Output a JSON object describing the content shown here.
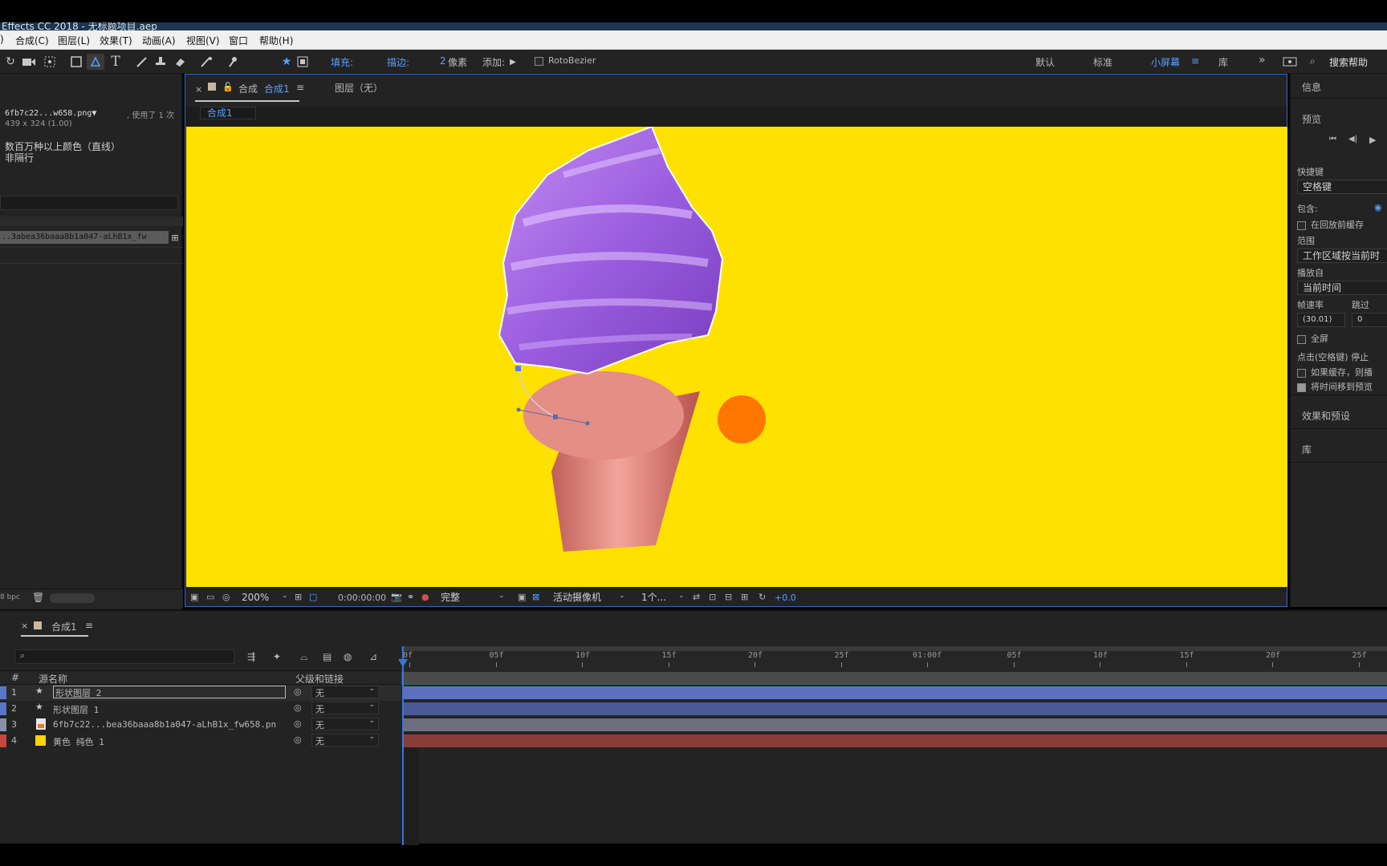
{
  "title_bar": {
    "text": "Effects CC 2018 - 无标题项目.aep"
  },
  "menu": [
    "合成(C)",
    "图层(L)",
    "效果(T)",
    "动画(A)",
    "视图(V)",
    "窗口",
    "帮助(H)"
  ],
  "toolbar": {
    "fill_label": "填充:",
    "stroke_label": "描边:",
    "stroke_width": "2",
    "stroke_unit": "像素",
    "add_label": "添加:",
    "rotobezier_label": "RotoBezier",
    "workspaces": [
      "默认",
      "标准",
      "小屏幕",
      "库"
    ],
    "active_workspace": "小屏幕",
    "search_help": "搜索帮助",
    "accent_color": "#2d8ceb"
  },
  "project": {
    "filename": "6fb7c22...w658.png▼",
    "used": ", 使用了 1 次",
    "dimensions": "439 x 324 (1.00)",
    "color_info": "数百万种以上颜色（直线）",
    "interlace": "非隔行",
    "selected_item": "..3abea36baaa8b1a047-aLhB1x_fw",
    "bpc": "8 bpc"
  },
  "comp_viewer": {
    "tab_label": "合成",
    "tab_name": "合成1",
    "layer_tab": "图层（无）",
    "breadcrumb": "合成1",
    "background_color": "#ffe100",
    "footer": {
      "zoom": "200%",
      "timecode": "0:00:00:00",
      "resolution": "完整",
      "camera": "活动摄像机",
      "views": "1个...",
      "exposure": "+0.0"
    }
  },
  "right_panel": {
    "info": "信息",
    "preview": "预览",
    "shortcut_label": "快捷键",
    "shortcut_value": "空格键",
    "include_label": "包含:",
    "cache_before_play": "在回放前缓存",
    "range_label": "范围",
    "range_value": "工作区域按当前时",
    "play_from_label": "播放自",
    "play_from_value": "当前时间",
    "fps_label": "帧速率",
    "skip_label": "跳过",
    "fps_value": "(30.01)",
    "skip_value": "0",
    "fullscreen": "全屏",
    "stop_hint": "点击(空格键) 停止",
    "if_cache": "如果缓存，则播",
    "move_time": "将时间移到预览",
    "effects_presets": "效果和预设",
    "library": "库"
  },
  "timeline": {
    "comp_tab": "合成1",
    "col_hash": "#",
    "col_source": "源名称",
    "col_parent": "父级和链接",
    "ruler": [
      "0f",
      "05f",
      "10f",
      "15f",
      "20f",
      "25f",
      "01:00f",
      "05f",
      "10f",
      "15f",
      "20f",
      "25f"
    ],
    "layers": [
      {
        "num": "1",
        "name": "形状图层 2",
        "parent": "无",
        "label_color": "#5a76c8",
        "bar_color": "#5d6fbf",
        "type": "shape"
      },
      {
        "num": "2",
        "name": "形状图层 1",
        "parent": "无",
        "label_color": "#5a76c8",
        "bar_color": "#4a5a96",
        "type": "shape"
      },
      {
        "num": "3",
        "name": "6fb7c22...bea36baaa8b1a047-aLhB1x_fw658.pn",
        "parent": "无",
        "label_color": "#8a8fa8",
        "bar_color": "#6b6f7e",
        "type": "footage"
      },
      {
        "num": "4",
        "name": "黄色 纯色 1",
        "parent": "无",
        "label_color": "#c8463c",
        "bar_color": "#8a3c38",
        "type": "solid"
      }
    ]
  }
}
